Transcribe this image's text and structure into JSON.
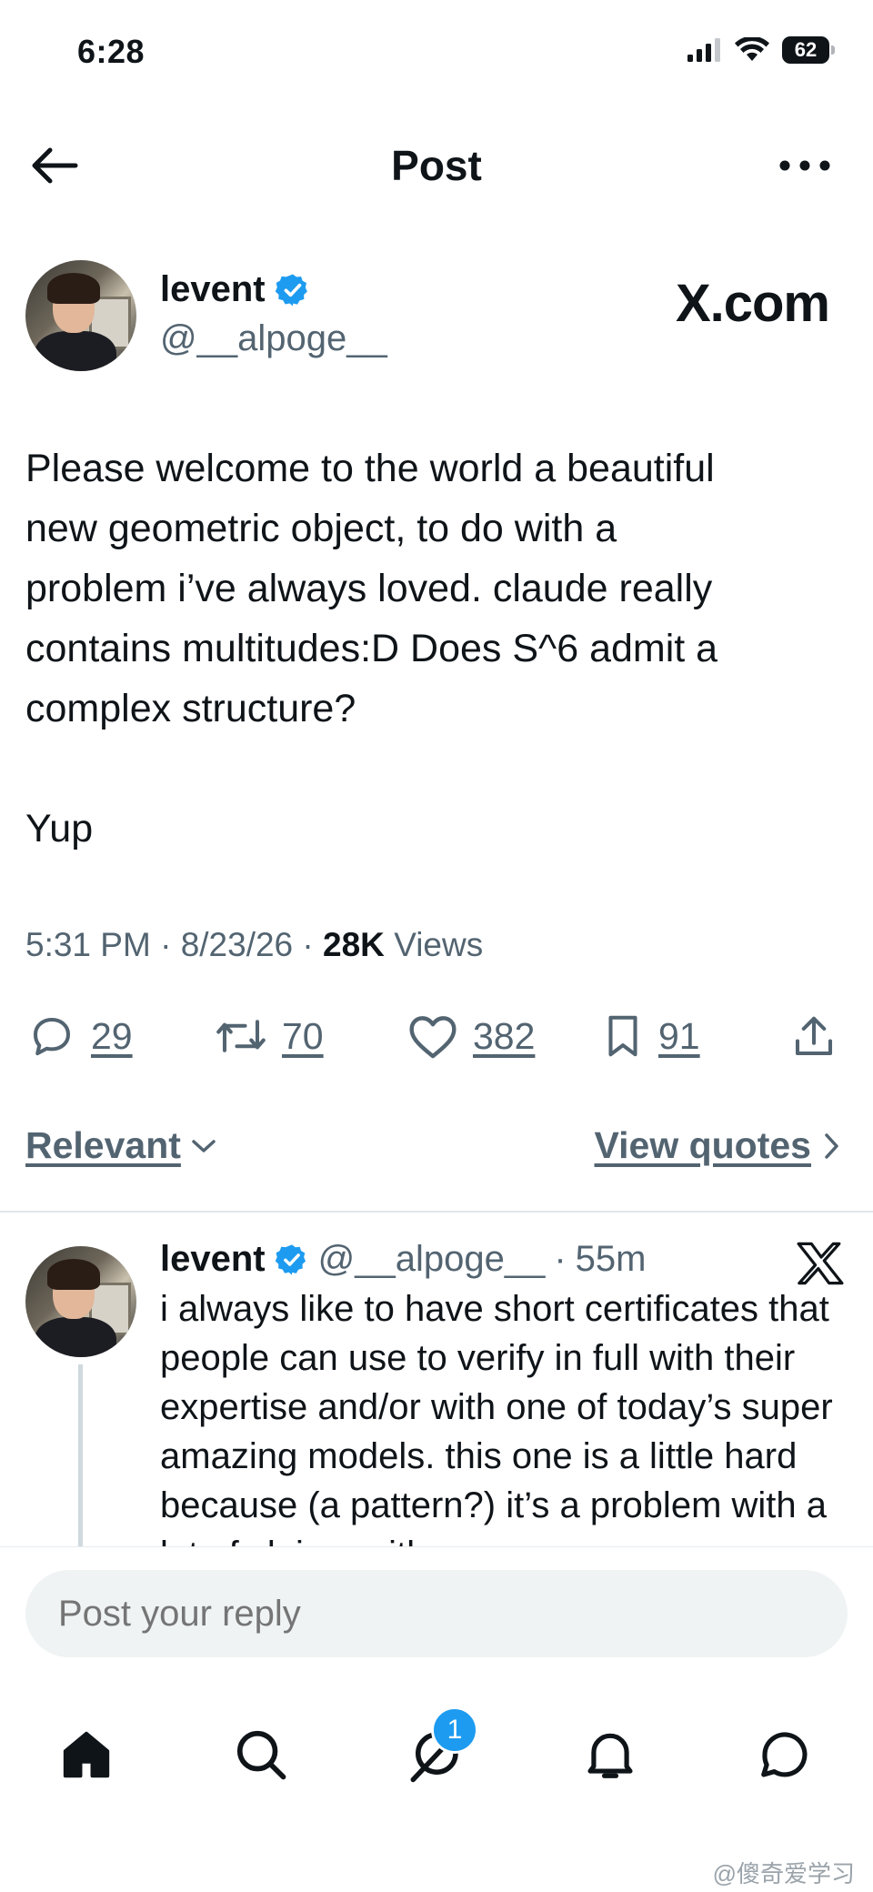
{
  "status": {
    "time": "6:28",
    "battery": "62"
  },
  "header": {
    "title": "Post"
  },
  "post": {
    "author": {
      "name": "levent",
      "handle": "@__alpoge__"
    },
    "badge_text": "X.com",
    "text": "Please welcome to the world a beautiful\nnew geometric object, to do with a\nproblem i’ve always loved. claude really\ncontains multitudes:D Does S^6 admit a\ncomplex structure?\n\nYup",
    "time": "5:31 PM",
    "date": "8/23/26",
    "views_count": "28K",
    "views_label": "Views",
    "actions": {
      "replies": "29",
      "reposts": "70",
      "likes": "382",
      "bookmarks": "91"
    }
  },
  "filters": {
    "sort_label": "Relevant",
    "quotes_label": "View quotes"
  },
  "reply": {
    "author": {
      "name": "levent",
      "handle": "@__alpoge__",
      "age": "55m"
    },
    "text": "i always like to have short certificates that people can use to verify in full with their expertise and/or with one of today’s super amazing models. this one is a little hard because (a pattern?) it’s a problem with a lot of claims with"
  },
  "composer": {
    "placeholder": "Post your reply"
  },
  "nav": {
    "messages_badge": "1"
  },
  "watermark": "@傻奇爱学习",
  "colors": {
    "accent": "#1d9bf0",
    "secondary_text": "#536471",
    "primary_text": "#0f1419"
  },
  "icons": [
    "back-arrow-icon",
    "more-icon",
    "verified-icon",
    "reply-icon",
    "repost-icon",
    "like-icon",
    "bookmark-icon",
    "share-icon",
    "chevron-down-icon",
    "chevron-right-icon",
    "x-logo-icon",
    "home-icon",
    "search-icon",
    "grok-icon",
    "bell-icon",
    "messages-icon"
  ]
}
